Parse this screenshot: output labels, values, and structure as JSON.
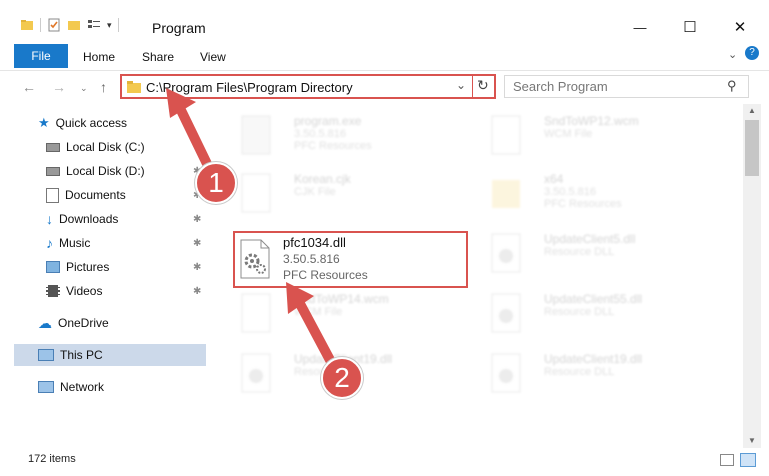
{
  "window": {
    "title": "Program",
    "minimize_glyph": "—",
    "maximize_glyph": "☐",
    "close_glyph": "✕"
  },
  "ribbon": {
    "tabs": [
      {
        "label": "File"
      },
      {
        "label": "Home"
      },
      {
        "label": "Share"
      },
      {
        "label": "View"
      }
    ]
  },
  "address_bar": {
    "path": "C:\\Program Files\\Program Directory"
  },
  "search": {
    "placeholder": "Search Program"
  },
  "sidebar": {
    "items": [
      {
        "label": "Quick access",
        "icon": "star-icon"
      },
      {
        "label": "Local Disk (C:)",
        "icon": "drive-icon"
      },
      {
        "label": "Local Disk (D:)",
        "icon": "drive-icon"
      },
      {
        "label": "Documents",
        "icon": "documents-icon"
      },
      {
        "label": "Downloads",
        "icon": "download-arrow-icon"
      },
      {
        "label": "Music",
        "icon": "music-note-icon"
      },
      {
        "label": "Pictures",
        "icon": "pictures-icon"
      },
      {
        "label": "Videos",
        "icon": "film-icon"
      },
      {
        "label": "OneDrive",
        "icon": "cloud-icon"
      },
      {
        "label": "This PC",
        "icon": "computer-icon"
      },
      {
        "label": "Network",
        "icon": "network-icon"
      }
    ]
  },
  "files": [
    {
      "name": "program.exe",
      "version": "3.50.5.816",
      "type": "PFC Resources"
    },
    {
      "name": "SndToWP12.wcm",
      "version": "",
      "type": "WCM File"
    },
    {
      "name": "Korean.cjk",
      "version": "",
      "type": "CJK File"
    },
    {
      "name": "x64",
      "version": "3.50.5.816",
      "type": "PFC Resources"
    },
    {
      "name": "UpdateClient5.dll",
      "version": "",
      "type": "Resource DLL"
    },
    {
      "name": "SndToWP14.wcm",
      "version": "",
      "type": "WCM File"
    },
    {
      "name": "UpdateClient55.dll",
      "version": "",
      "type": "Resource DLL"
    },
    {
      "name": "UpdateClient19.dll",
      "version": "",
      "type": "Resource DLL"
    },
    {
      "name": "UpdateClient19.dll",
      "version": "",
      "type": "Resource DLL"
    }
  ],
  "highlighted_file": {
    "name": "pfc1034.dll",
    "version": "3.50.5.816",
    "type": "PFC Resources"
  },
  "annotations": {
    "step1": "1",
    "step2": "2",
    "color": "#d9534f"
  },
  "status": {
    "item_count": "172 items"
  }
}
